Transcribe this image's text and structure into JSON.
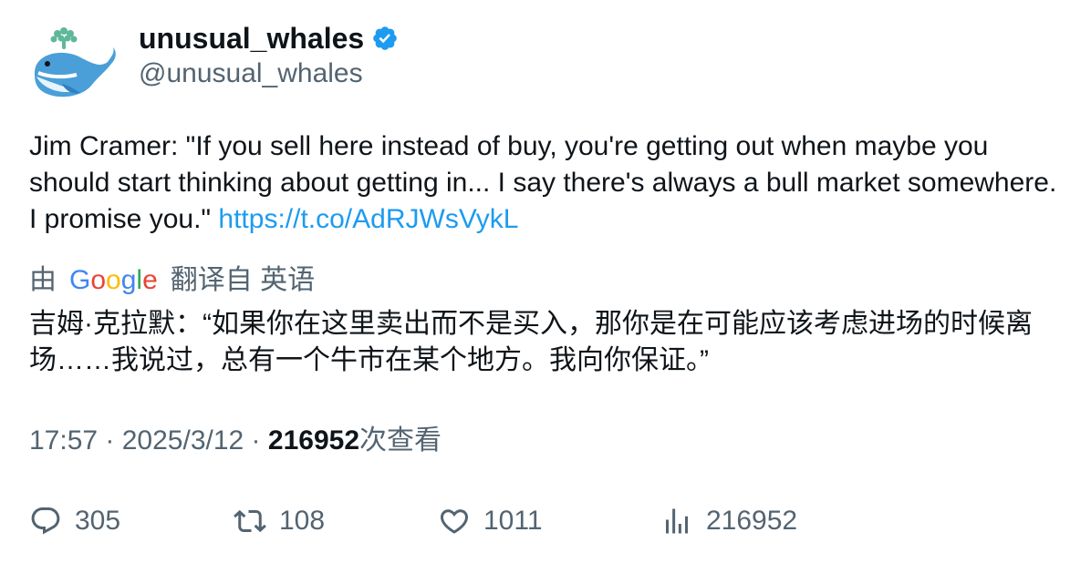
{
  "author": {
    "display_name": "unusual_whales",
    "handle": "@unusual_whales",
    "verified_icon": "verified-badge-icon",
    "avatar_icon": "whale-avatar"
  },
  "tweet": {
    "text": "Jim Cramer: \"If you sell here instead of buy, you're getting out when maybe you should start thinking about getting in... I say there's always a bull market somewhere. I promise you.\" ",
    "link": "https://t.co/AdRJWsVykL"
  },
  "translation": {
    "by": "由",
    "provider": "Google",
    "label": "翻译自 英语",
    "text": "吉姆·克拉默：“如果你在这里卖出而不是买入，那你是在可能应该考虑进场的时候离场……我说过，总有一个牛市在某个地方。我向你保证。”"
  },
  "meta": {
    "time": "17:57",
    "sep1": " · ",
    "date": "2025/3/12",
    "sep2": " · ",
    "views": "216952",
    "views_label": "次查看"
  },
  "actions": {
    "replies": "305",
    "retweets": "108",
    "likes": "1011",
    "views": "216952"
  },
  "colors": {
    "link": "#1d9bf0",
    "secondary_text": "#536471",
    "primary_text": "#0f1419"
  }
}
